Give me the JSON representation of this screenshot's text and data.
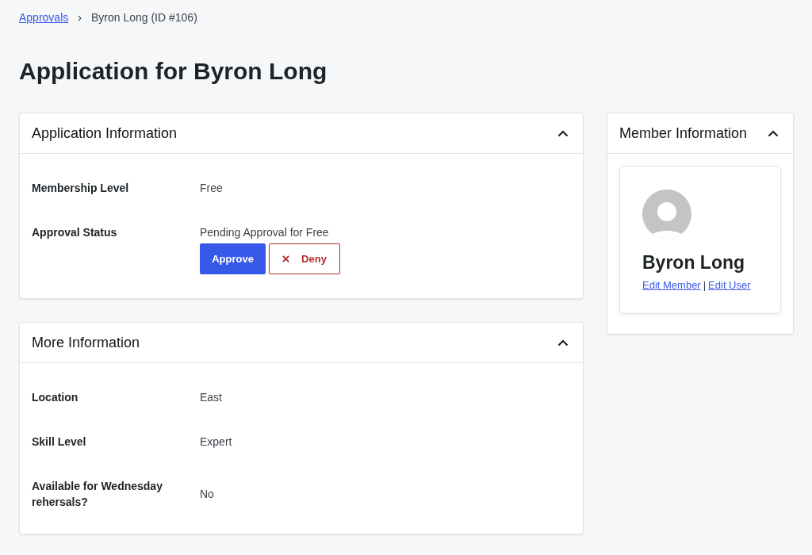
{
  "breadcrumb": {
    "items": [
      {
        "label": "Approvals",
        "kind": "link"
      },
      {
        "label": "Byron Long (ID #106)",
        "kind": "current"
      }
    ],
    "separator": "›"
  },
  "page_title": "Application for Byron Long",
  "main_panels": [
    {
      "title": "Application Information",
      "expanded": true,
      "rows": [
        {
          "label": "Membership Level",
          "value": "Free"
        },
        {
          "label": "Approval Status",
          "value": "Pending Approval for Free",
          "actions": [
            {
              "label": "Approve",
              "kind": "primary"
            },
            {
              "label": "Deny",
              "kind": "danger"
            }
          ]
        }
      ]
    },
    {
      "title": "More Information",
      "expanded": true,
      "rows": [
        {
          "label": "Location",
          "value": "East"
        },
        {
          "label": "Skill Level",
          "value": "Expert"
        },
        {
          "label": "Available for Wednesday rehersals?",
          "value": "No"
        }
      ]
    }
  ],
  "member_panel": {
    "title": "Member Information",
    "expanded": true,
    "name": "Byron Long",
    "links": [
      "Edit Member",
      "Edit User"
    ],
    "link_separator": "|"
  }
}
